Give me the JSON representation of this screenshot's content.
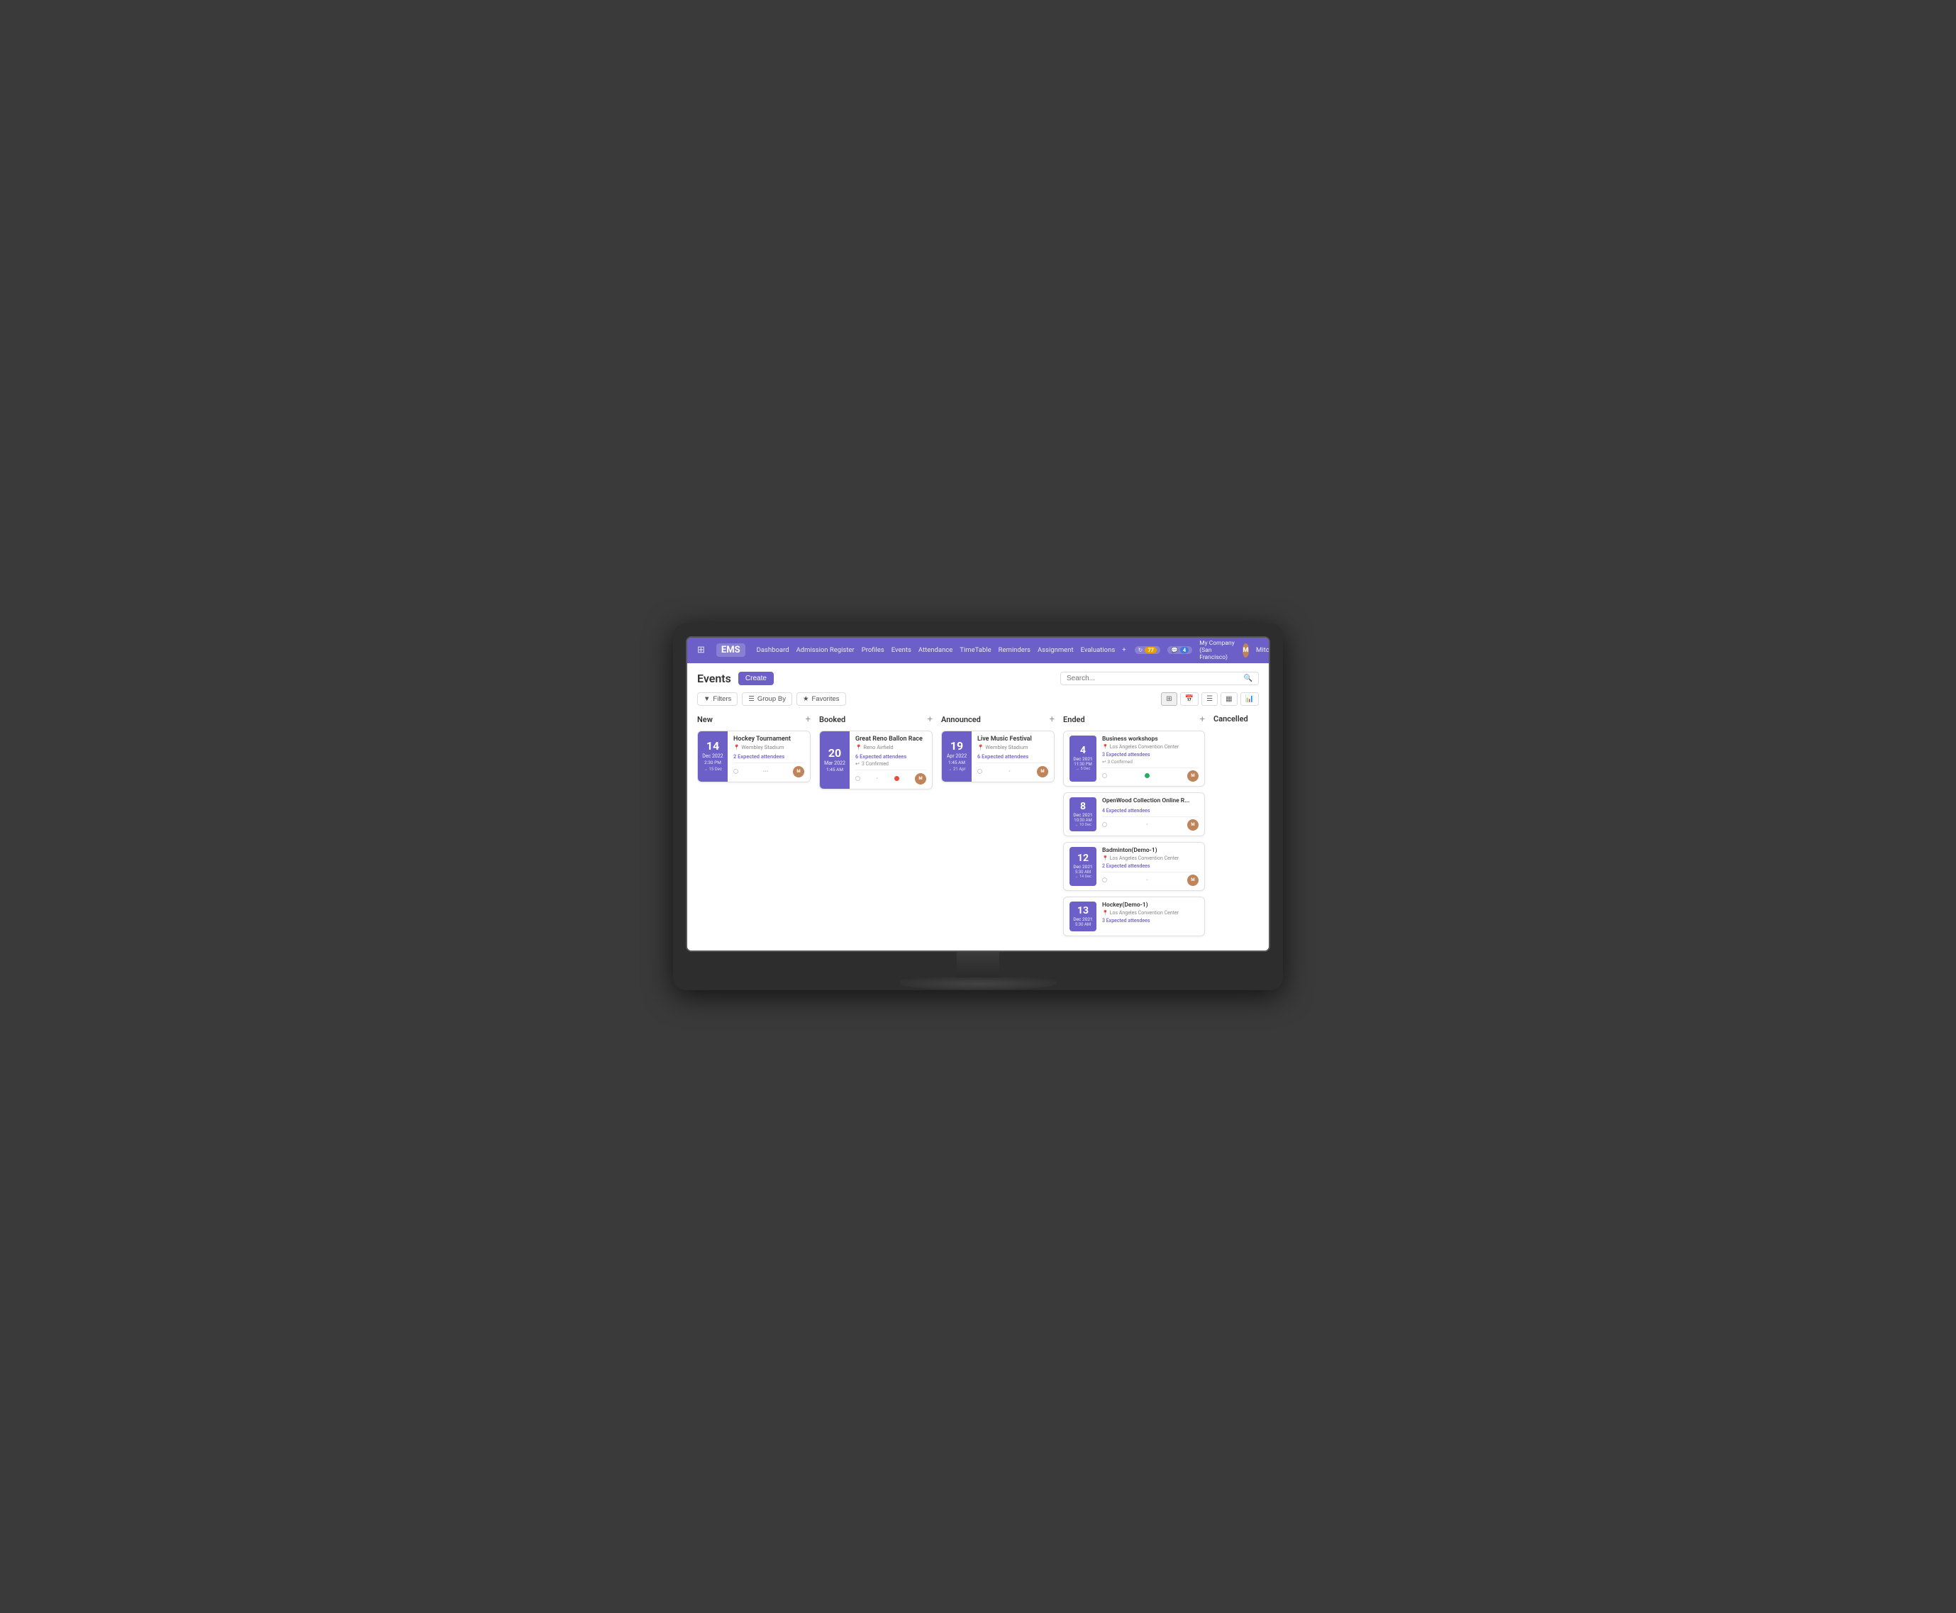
{
  "app": {
    "brand": "EMS",
    "nav_links": [
      "Dashboard",
      "Admission Register",
      "Profiles",
      "Events",
      "Attendance",
      "TimeTable",
      "Reminders",
      "Assignment",
      "Evaluations"
    ],
    "nav_add": "+",
    "badge_notification_count": "77",
    "badge_message_count": "4",
    "company": "My Company (San Francisco)",
    "user": "Mitchell Admin"
  },
  "page": {
    "title": "Events",
    "create_label": "Create",
    "search_placeholder": "Search...",
    "filters_label": "Filters",
    "group_by_label": "Group By",
    "favorites_label": "Favorites"
  },
  "columns": [
    {
      "id": "new",
      "title": "New"
    },
    {
      "id": "booked",
      "title": "Booked"
    },
    {
      "id": "announced",
      "title": "Announced"
    },
    {
      "id": "ended",
      "title": "Ended"
    },
    {
      "id": "cancelled",
      "title": "Cancelled"
    }
  ],
  "cards": {
    "new": [
      {
        "day": "14",
        "month": "Dec 2022",
        "time": "2:30 PM",
        "end": "→ 15 Dec",
        "title": "Hockey Tournament",
        "venue": "Wembley Stadium",
        "badge": "2 Expected attendees",
        "confirmed": null,
        "status": "empty",
        "avatar_color": "brown"
      }
    ],
    "booked": [
      {
        "day": "20",
        "month": "Mar 2022",
        "time": "1:45 AM",
        "end": "",
        "title": "Great Reno Ballon Race",
        "venue": "Reno Airfield",
        "badge": "6 Expected attendees",
        "confirmed": "3 Confirmed",
        "status": "red",
        "avatar_color": "brown"
      }
    ],
    "announced": [
      {
        "day": "19",
        "month": "Apr 2022",
        "time": "1:45 AM",
        "end": "→ 21 Apr",
        "title": "Live Music Festival",
        "venue": "Wembley Stadium",
        "badge": "6 Expected attendees",
        "confirmed": null,
        "status": "empty",
        "avatar_color": "brown"
      }
    ],
    "ended": [
      {
        "day": "4",
        "month": "Dec 2021",
        "time": "11:30 PM",
        "end": "→ 5 Dec",
        "title": "Business workshops",
        "venue": "Los Angeles Convention Center",
        "badge": "3 Expected attendees",
        "confirmed": "3 Confirmed",
        "status": "green",
        "avatar_color": "brown"
      },
      {
        "day": "8",
        "month": "Dec 2021",
        "time": "10:30 AM",
        "end": "→ 10 Dec",
        "title": "OpenWood Collection Online R...",
        "venue": "",
        "badge": "4 Expected attendees",
        "confirmed": null,
        "status": "empty",
        "avatar_color": "brown"
      },
      {
        "day": "12",
        "month": "Dec 2021",
        "time": "5:30 AM",
        "end": "→ 14 Dec",
        "title": "Badminton(Demo-1)",
        "venue": "Los Angeles Convention Center",
        "badge": "2 Expected attendees",
        "confirmed": null,
        "status": "empty",
        "avatar_color": "brown"
      },
      {
        "day": "13",
        "month": "Dec 2021",
        "time": "5:30 AM",
        "end": "",
        "title": "Hockey(Demo-1)",
        "venue": "Los Angeles Convention Center",
        "badge": "3 Expected attendees",
        "confirmed": null,
        "status": "empty",
        "avatar_color": "brown"
      }
    ]
  }
}
